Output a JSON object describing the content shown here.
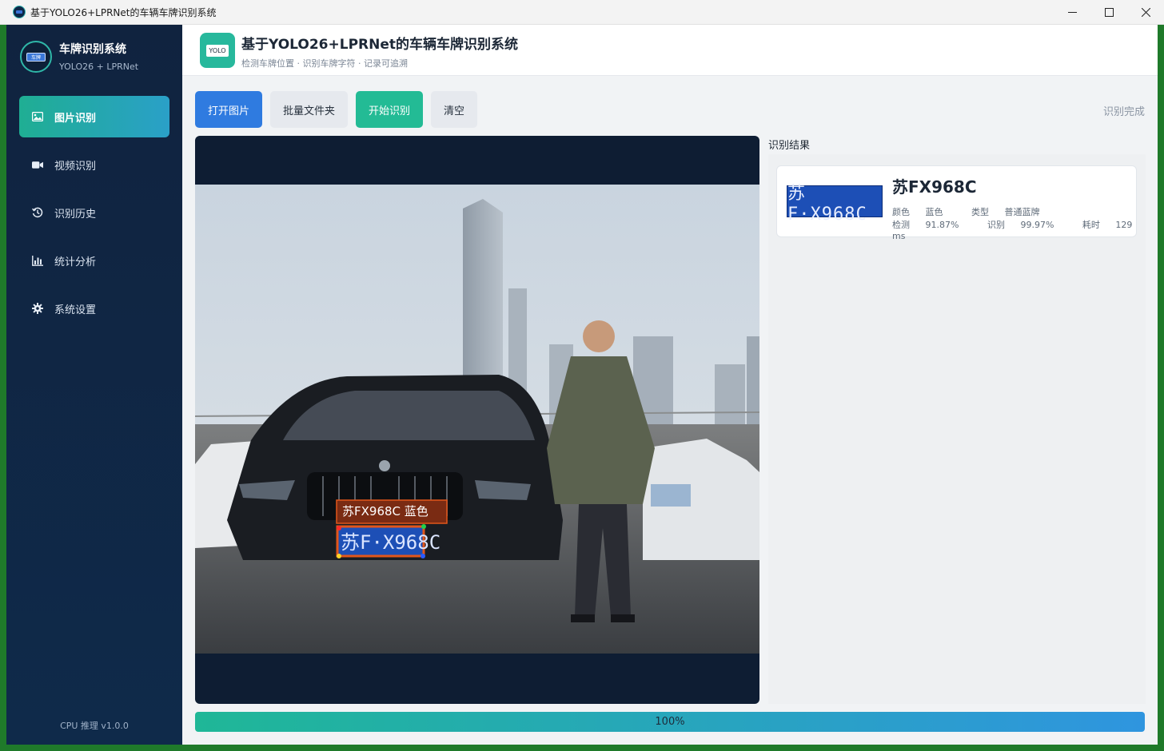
{
  "window": {
    "title": "基于YOLO26+LPRNet的车辆车牌识别系统",
    "controls": [
      "minimize-icon",
      "maximize-icon",
      "close-icon"
    ]
  },
  "sidebar": {
    "brand_name": "车牌识别系统",
    "brand_sub": "YOLO26 + LPRNet",
    "logo_text": "车牌",
    "items": [
      {
        "label": "图片识别",
        "icon": "image-icon",
        "active": true
      },
      {
        "label": "视频识别",
        "icon": "video-icon",
        "active": false
      },
      {
        "label": "识别历史",
        "icon": "history-icon",
        "active": false
      },
      {
        "label": "统计分析",
        "icon": "chart-icon",
        "active": false
      },
      {
        "label": "系统设置",
        "icon": "gear-icon",
        "active": false
      }
    ],
    "footer": "CPU 推理  v1.0.0"
  },
  "header": {
    "logo_text": "YOLO",
    "title": "基于YOLO26+LPRNet的车辆车牌识别系统",
    "subtitle": "检测车牌位置 · 识别车牌字符 · 记录可追溯"
  },
  "toolbar": {
    "open_image": "打开图片",
    "batch_folder": "批量文件夹",
    "start": "开始识别",
    "clear": "清空",
    "status": "识别完成"
  },
  "viewer": {
    "overlay_label": "苏FX968C   蓝色",
    "plate_text": "苏F·X968C"
  },
  "results": {
    "label": "识别结果",
    "plate_thumb_text": "苏F·X968C",
    "plate_number": "苏FX968C",
    "color_label": "颜色",
    "color_value": "蓝色",
    "type_label": "类型",
    "type_value": "普通蓝牌",
    "det_label": "检测",
    "det_value": "91.87%",
    "rec_label": "识别",
    "rec_value": "99.97%",
    "time_label": "耗时",
    "time_value": "129 ms"
  },
  "progress": {
    "text": "100%",
    "value": 1.0
  },
  "colors": {
    "sidebar_bg": "#10233f",
    "accent_teal": "#1fae93",
    "accent_blue": "#2f7be0",
    "plate_blue": "#1d4fb6",
    "box_orange": "#e2561b"
  }
}
